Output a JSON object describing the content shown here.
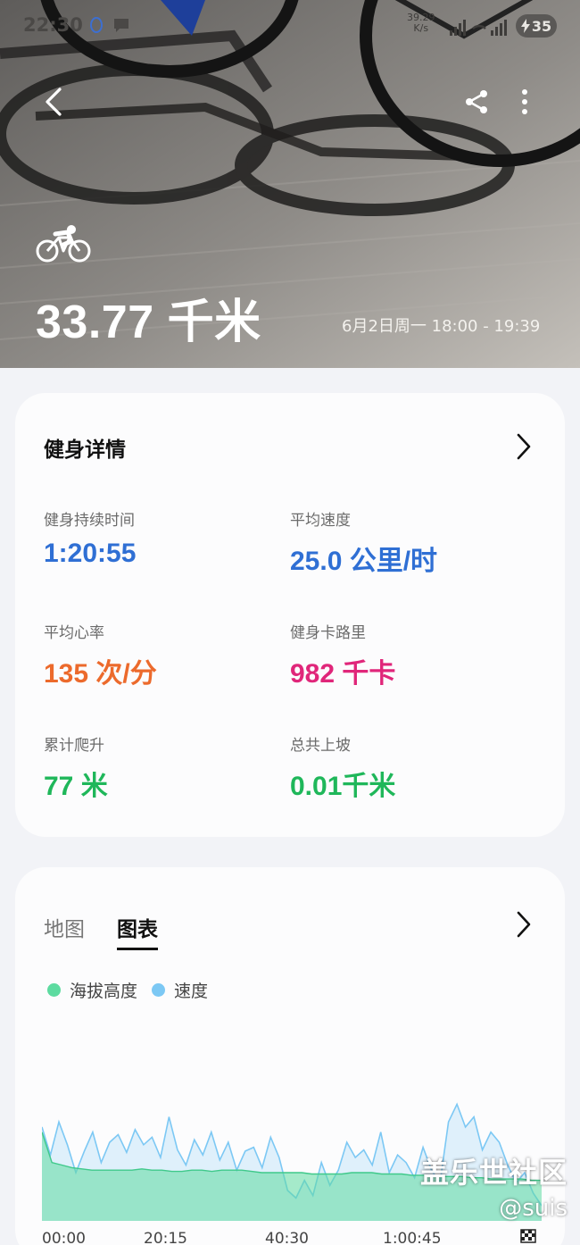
{
  "status_bar": {
    "time": "22:30",
    "net_speed": "39.29",
    "net_unit": "K/s",
    "battery": "35"
  },
  "hero": {
    "distance": "33.77 千米",
    "datetime": "6月2日周一 18:00 - 19:39",
    "activity_icon": "cycling-icon"
  },
  "details": {
    "title": "健身详情",
    "metrics": [
      {
        "label": "健身持续时间",
        "value": "1:20:55",
        "color": "#2f6fd4"
      },
      {
        "label": "平均速度",
        "value": "25.0 公里/时",
        "color": "#2f6fd4"
      },
      {
        "label": "平均心率",
        "value": "135 次/分",
        "color": "#ec6a2c"
      },
      {
        "label": "健身卡路里",
        "value": "982 千卡",
        "color": "#e0267a"
      },
      {
        "label": "累计爬升",
        "value": "77 米",
        "color": "#1fb75a"
      },
      {
        "label": "总共上坡",
        "value": "0.01千米",
        "color": "#1fb75a"
      }
    ]
  },
  "chart_card": {
    "tabs": [
      {
        "label": "地图",
        "active": false
      },
      {
        "label": "图表",
        "active": true
      }
    ],
    "legend": [
      {
        "label": "海拔高度",
        "color": "#5ddba0"
      },
      {
        "label": "速度",
        "color": "#7cc8f4"
      }
    ],
    "x_ticks": [
      "00:00",
      "20:15",
      "40:30",
      "1:00:45"
    ]
  },
  "chart_data": {
    "type": "area",
    "xlabel": "",
    "ylabel": "",
    "x_ticks": [
      "00:00",
      "20:15",
      "40:30",
      "1:00:45"
    ],
    "x_range_minutes": [
      0,
      80.9
    ],
    "series": [
      {
        "name": "海拔高度",
        "color": "#5ddba0",
        "values": [
          0.7,
          0.46,
          0.44,
          0.42,
          0.41,
          0.4,
          0.4,
          0.4,
          0.4,
          0.4,
          0.41,
          0.4,
          0.4,
          0.39,
          0.39,
          0.4,
          0.4,
          0.39,
          0.4,
          0.4,
          0.4,
          0.39,
          0.38,
          0.38,
          0.38,
          0.38,
          0.38,
          0.37,
          0.37,
          0.37,
          0.37,
          0.38,
          0.38,
          0.38,
          0.37,
          0.37,
          0.37,
          0.36,
          0.36,
          0.36,
          0.35,
          0.35,
          0.35,
          0.34,
          0.34,
          0.33,
          0.33,
          0.33,
          0.33,
          0.32,
          0.32
        ]
      },
      {
        "name": "速度",
        "color": "#7cc8f4",
        "values": [
          0.74,
          0.52,
          0.78,
          0.6,
          0.38,
          0.55,
          0.7,
          0.46,
          0.62,
          0.68,
          0.54,
          0.72,
          0.6,
          0.66,
          0.5,
          0.82,
          0.56,
          0.44,
          0.64,
          0.52,
          0.7,
          0.48,
          0.62,
          0.4,
          0.55,
          0.58,
          0.42,
          0.66,
          0.5,
          0.24,
          0.18,
          0.32,
          0.2,
          0.46,
          0.28,
          0.4,
          0.62,
          0.5,
          0.56,
          0.44,
          0.7,
          0.38,
          0.52,
          0.46,
          0.34,
          0.58,
          0.4,
          0.3,
          0.78,
          0.92,
          0.74,
          0.82,
          0.56,
          0.7,
          0.62,
          0.44,
          0.3,
          0.38,
          0.22,
          0.12
        ]
      }
    ]
  },
  "watermark": {
    "line1": "盖乐世社区",
    "line2": "@suis"
  }
}
